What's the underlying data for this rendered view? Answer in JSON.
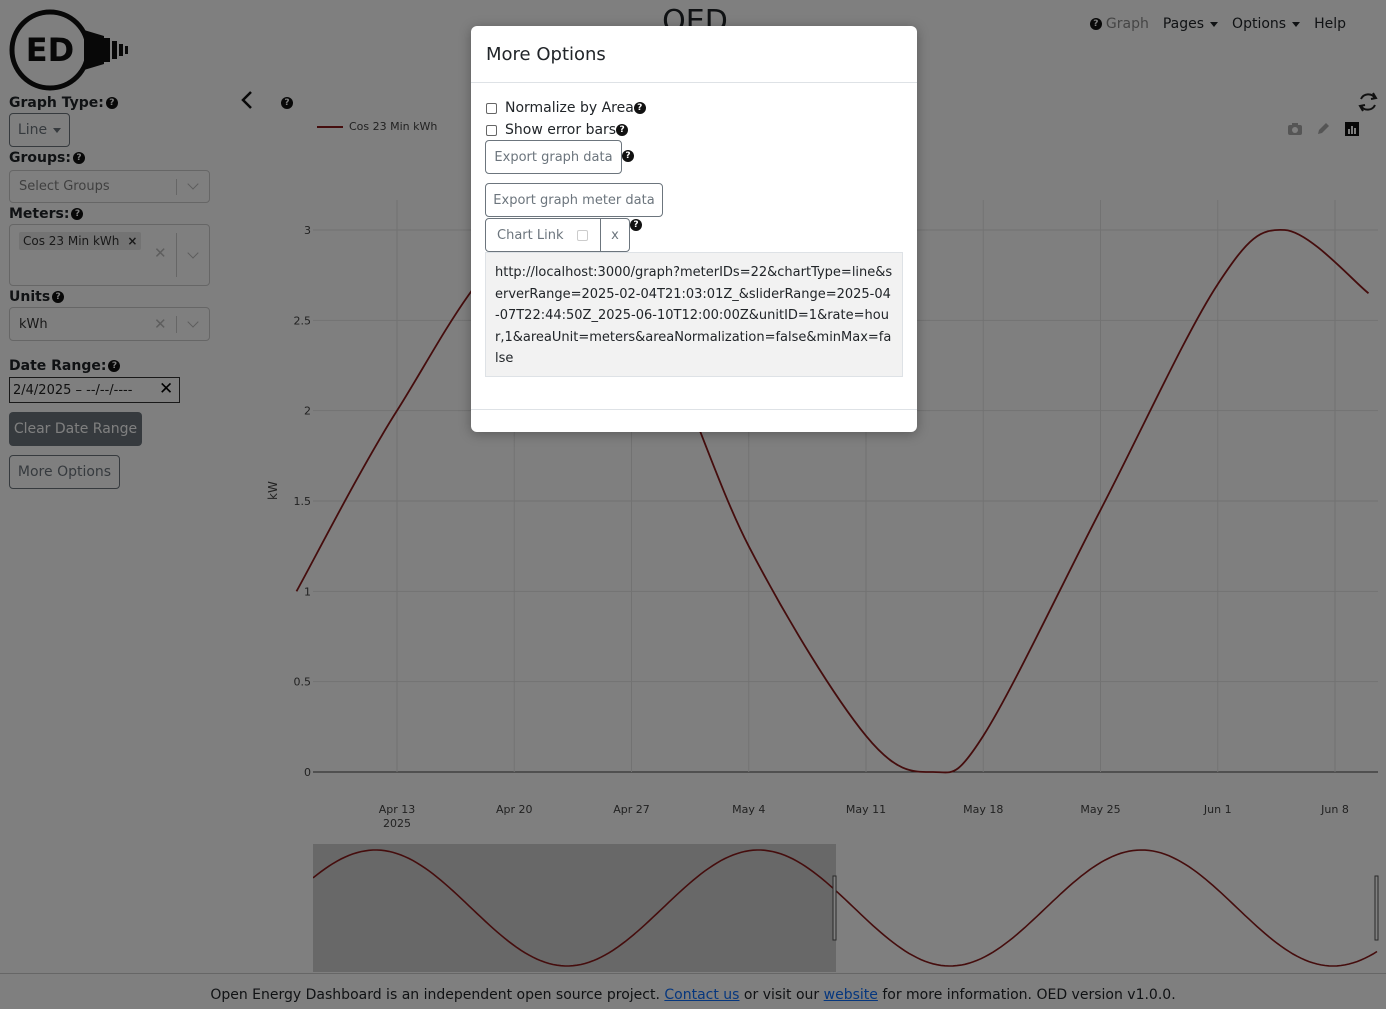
{
  "app": {
    "title": "OED",
    "logo_text": "ED"
  },
  "nav": {
    "graph": "Graph",
    "pages": "Pages",
    "options": "Options",
    "help": "Help"
  },
  "sidebar": {
    "graph_type_label": "Graph Type:",
    "graph_type_value": "Line",
    "groups_label": "Groups:",
    "groups_placeholder": "Select Groups",
    "meters_label": "Meters:",
    "meter_chip": "Cos 23 Min kWh",
    "units_label": "Units",
    "units_value": "kWh",
    "date_range_label": "Date Range:",
    "date_range_value": "2/4/2025 – --/--/----",
    "clear_date_range": "Clear Date Range",
    "more_options": "More Options"
  },
  "chart_data": {
    "type": "line",
    "title": "",
    "xlabel": "",
    "ylabel": "kW",
    "legend": [
      "Cos 23 Min kWh"
    ],
    "legend_position": "top-left",
    "series_color": "#8b1a1a",
    "ylim": [
      0,
      3.2
    ],
    "y_ticks": [
      "0",
      "0.5",
      "1",
      "1.5",
      "2",
      "2.5",
      "3"
    ],
    "x_ticks": [
      "Apr 13",
      "Apr 20",
      "Apr 27",
      "May 4",
      "May 11",
      "May 18",
      "May 25",
      "Jun 1",
      "Jun 8"
    ],
    "x_tick_year": "2025",
    "grid": true,
    "series": [
      {
        "name": "Cos 23 Min kWh",
        "x": [
          "2025-04-07",
          "2025-04-13",
          "2025-04-20",
          "2025-04-27",
          "2025-05-04",
          "2025-05-11",
          "2025-05-15",
          "2025-05-18",
          "2025-05-25",
          "2025-06-01",
          "2025-06-05",
          "2025-06-10"
        ],
        "values": [
          1.0,
          2.0,
          2.9,
          2.7,
          1.25,
          0.2,
          0.0,
          0.2,
          1.45,
          2.7,
          3.0,
          2.65
        ]
      }
    ]
  },
  "modal": {
    "title": "More Options",
    "normalize_label": "Normalize by Area",
    "error_bars_label": "Show error bars",
    "export_graph": "Export graph data",
    "export_meter": "Export graph meter data",
    "chart_link": "Chart Link",
    "chart_link_close": "x",
    "url": "http://localhost:3000/graph?meterIDs=22&chartType=line&serverRange=2025-02-04T21:03:01Z_&sliderRange=2025-04-07T22:44:50Z_2025-06-10T12:00:00Z&unitID=1&rate=hour,1&areaUnit=meters&areaNormalization=false&minMax=false"
  },
  "footer": {
    "prefix": "Open Energy Dashboard is an independent open source project.",
    "contact": "Contact us",
    "middle": "or visit our",
    "website": "website",
    "suffix": "for more information. OED version v1.0.0."
  }
}
